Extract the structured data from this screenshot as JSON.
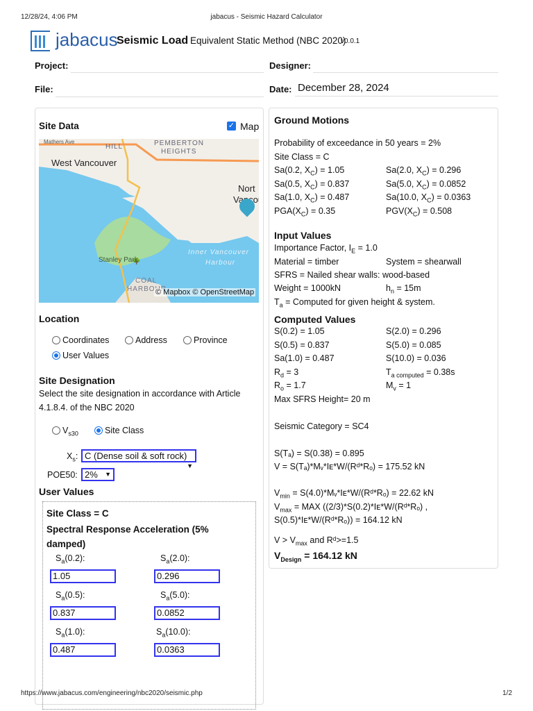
{
  "print_header": {
    "datetime": "12/28/24, 4:06 PM",
    "title": "jabacus - Seismic Hazard Calculator"
  },
  "print_footer": {
    "url": "https://www.jabacus.com/engineering/nbc2020/seismic.php",
    "page": "1/2"
  },
  "header": {
    "logo": "jabacus",
    "app_title": "Seismic Load",
    "subtitle": "Equivalent Static Method (NBC 2020)",
    "version": "v0.0.1"
  },
  "form": {
    "project_label": "Project:",
    "project_value": "",
    "designer_label": "Designer:",
    "designer_value": "",
    "file_label": "File:",
    "file_value": "",
    "date_label": "Date:",
    "date_value": "December 28, 2024"
  },
  "site_data": {
    "title": "Site Data",
    "map_label": "Map",
    "map_checked": true,
    "map_labels": {
      "mathers": "Mathers Ave",
      "hill": "HILL",
      "pemberton": "PEMBERTON",
      "heights": "HEIGHTS",
      "west_van": "West Vancouver",
      "north": "Nort",
      "vancouver": "Vancou",
      "stanley": "Stanley Park",
      "inner": "Inner Vancouver",
      "harbour": "Harbour",
      "coal": "COAL",
      "coal_harbour": "HARBOUR"
    },
    "attribution": "© Mapbox © OpenStreetMap"
  },
  "location": {
    "title": "Location",
    "options": [
      "Coordinates",
      "Address",
      "Province",
      "User Values"
    ],
    "selected": "User Values"
  },
  "site_designation": {
    "title": "Site Designation",
    "description": "Select the site designation in accordance with Article 4.1.8.4. of the NBC 2020",
    "vs30_label": "V",
    "vs30_sub": "s30",
    "site_class_label": "Site Class",
    "selected": "Site Class",
    "xs_label": "X",
    "xs_sub": "s",
    "xs_colon": ":",
    "xs_value": "C (Dense soil & soft rock)",
    "poe_label": "POE50:",
    "poe_value": "2%"
  },
  "user_values": {
    "title": "User Values",
    "site_class": "Site Class = C",
    "spectral_title": "Spectral Response Acceleration (5% damped)",
    "fields": [
      {
        "label": "(0.2):",
        "value": "1.05"
      },
      {
        "label": "(2.0):",
        "value": "0.296"
      },
      {
        "label": "(0.5):",
        "value": "0.837"
      },
      {
        "label": "(5.0):",
        "value": "0.0852"
      },
      {
        "label": "(1.0):",
        "value": "0.487"
      },
      {
        "label": "(10.0):",
        "value": "0.0363"
      }
    ]
  },
  "ground_motions": {
    "title": "Ground Motions",
    "poe": "Probability of exceedance in 50 years = 2%",
    "site_class": "Site Class = C",
    "rows": [
      [
        "Sa(0.2, X",
        "C",
        ") = 1.05",
        "Sa(2.0, X",
        "C",
        ") = 0.296"
      ],
      [
        "Sa(0.5, X",
        "C",
        ") = 0.837",
        "Sa(5.0, X",
        "C",
        ") = 0.0852"
      ],
      [
        "Sa(1.0, X",
        "C",
        ") = 0.487",
        "Sa(10.0, X",
        "C",
        ") = 0.0363"
      ],
      [
        "PGA(X",
        "C",
        ") = 0.35",
        "PGV(X",
        "C",
        ") = 0.508"
      ]
    ]
  },
  "input_values": {
    "title": "Input Values",
    "importance": "Importance Factor, I",
    "importance_sub": "E",
    "importance_val": " = 1.0",
    "material": "Material = timber",
    "system": "System = shearwall",
    "sfrs": "SFRS = Nailed shear walls: wood-based",
    "weight": "Weight = 1000kN",
    "hn": "h",
    "hn_sub": "n",
    "hn_val": " = 15m",
    "ta": "T",
    "ta_sub": "a",
    "ta_val": " = Computed for given height & system."
  },
  "computed": {
    "title": "Computed Values",
    "s02": "S(0.2) = 1.05",
    "s20": "S(2.0) = 0.296",
    "s05": "S(0.5) = 0.837",
    "s50": "S(5.0) = 0.085",
    "sa10": "Sa(1.0) = 0.487",
    "s100": "S(10.0) = 0.036",
    "rd": "R",
    "rd_sub": "d",
    "rd_val": " = 3",
    "ta": "T",
    "ta_sub": "a computed",
    "ta_val": " = 0.38s",
    "ro": "R",
    "ro_sub": "o",
    "ro_val": " = 1.7",
    "mv": "M",
    "mv_sub": "v",
    "mv_val": " = 1",
    "max_height": "Max SFRS Height= 20 m",
    "category": "Seismic Category = SC4",
    "sta": "S(Tₐ) = S(0.38) = 0.895",
    "v": "V = S(Tₐ)*Mᵥ*Iᴇ*W/(Rᵈ*Rₒ) = 175.52 kN",
    "vmin_sub": "min",
    "vmin": " = S(4.0)*Mᵥ*Iᴇ*W/(Rᵈ*Rₒ) = 22.62 kN",
    "vmax_sub": "max",
    "vmax": " = MAX ((2/3)*S(0.2)*Iᴇ*W/(Rᵈ*Rₒ) ,",
    "vmax2": "S(0.5)*Iᴇ*W/(Rᵈ*Rₒ)) = 164.12 kN",
    "cond_a": "V > V",
    "cond_sub": "max",
    "cond_b": " and Rᵈ>=1.5",
    "design_sub": "Design",
    "design": " = 164.12 kN"
  }
}
